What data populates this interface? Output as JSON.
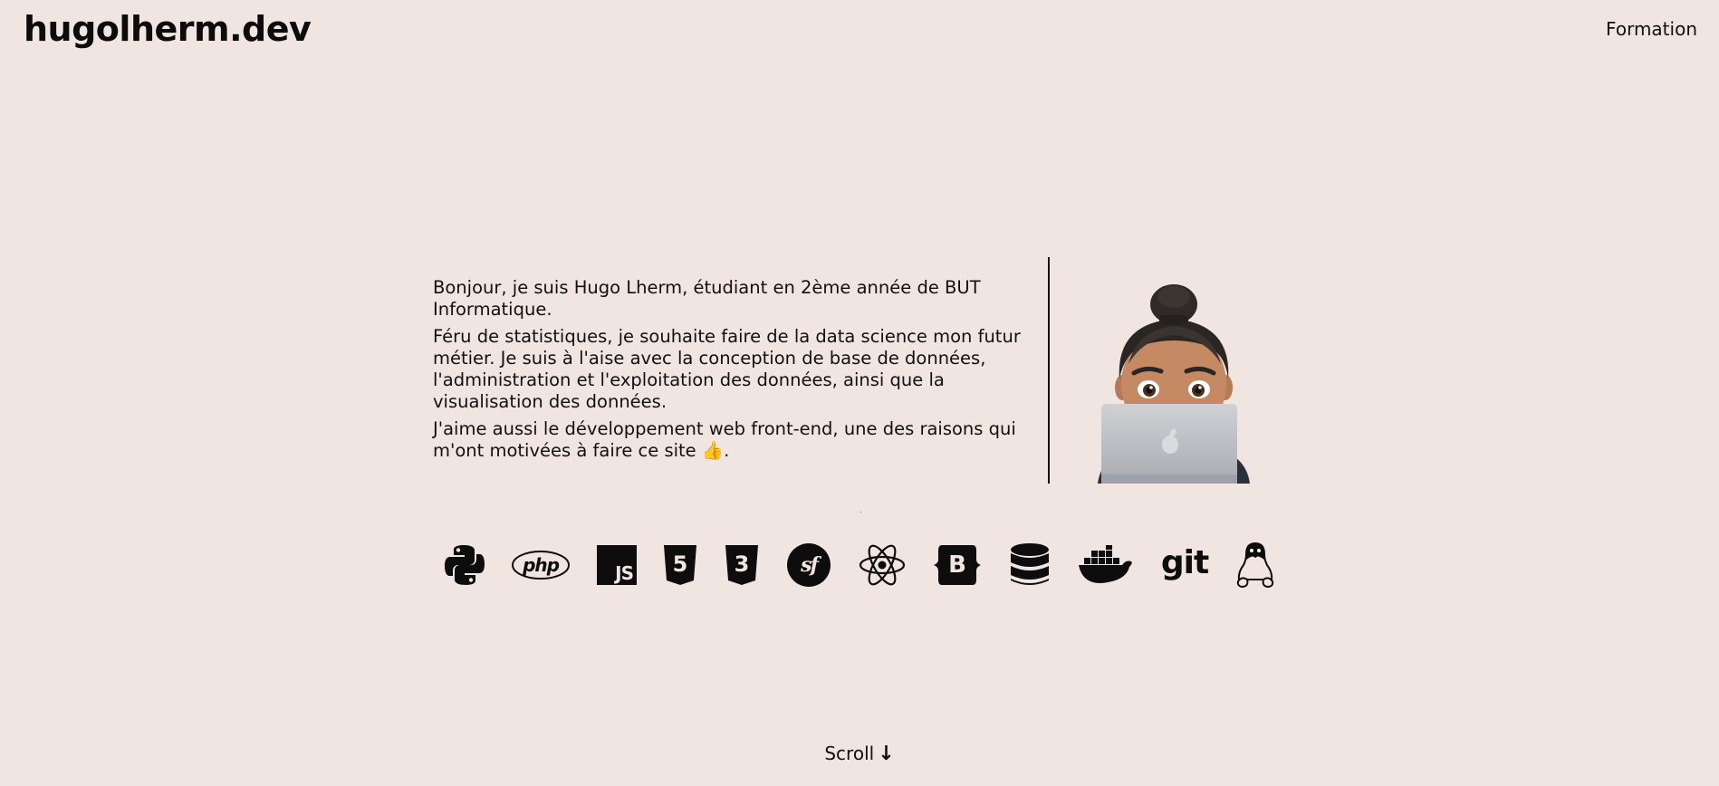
{
  "header": {
    "brand": "hugolherm.dev",
    "nav": [
      {
        "label": "Formation"
      }
    ]
  },
  "intro": {
    "paragraphs": [
      "Bonjour, je suis Hugo Lherm, étudiant en 2ème année de BUT Informatique.",
      "Féru de statistiques, je souhaite faire de la data science mon futur métier. Je suis à l'aise avec la conception de base de données, l'administration et l'exploitation des données, ainsi que la visualisation des données.",
      "J'aime aussi le développement web front-end, une des raisons qui m'ont motivées à faire ce site 👍."
    ]
  },
  "avatar": {
    "icon": "memoji-laptop-avatar"
  },
  "skills": {
    "items": [
      {
        "icon": "python-icon"
      },
      {
        "icon": "php-icon",
        "label": "php"
      },
      {
        "icon": "javascript-icon",
        "label": "JS"
      },
      {
        "icon": "html5-icon",
        "label": "5"
      },
      {
        "icon": "css3-icon",
        "label": "3"
      },
      {
        "icon": "symfony-icon",
        "label": "sf"
      },
      {
        "icon": "react-icon"
      },
      {
        "icon": "bootstrap-icon",
        "label": "B"
      },
      {
        "icon": "database-icon"
      },
      {
        "icon": "docker-icon"
      },
      {
        "icon": "git-icon",
        "label": "git"
      },
      {
        "icon": "linux-icon"
      }
    ]
  },
  "footer": {
    "scroll_label": "Scroll",
    "scroll_arrow": "↓"
  }
}
